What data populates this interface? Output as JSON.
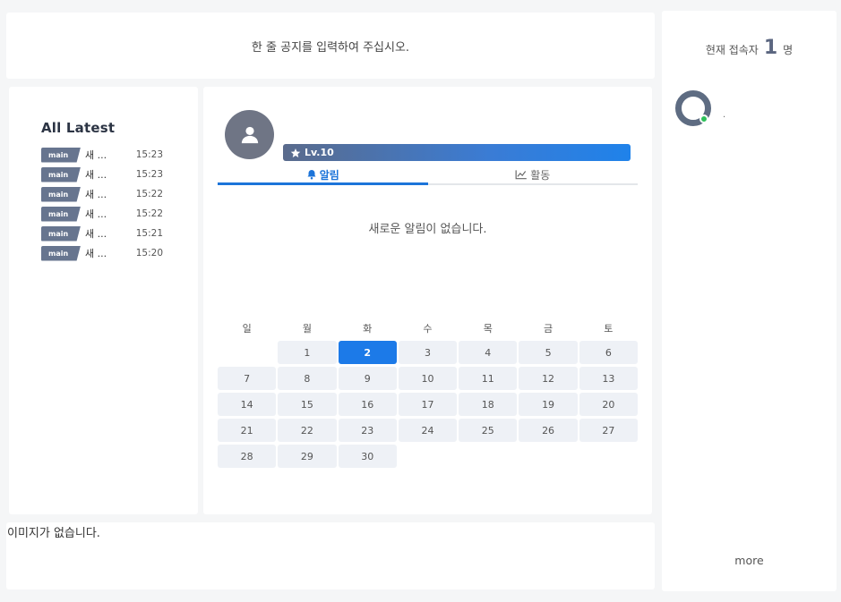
{
  "notice": {
    "text": "한 줄 공지를 입력하여 주십시오."
  },
  "latest": {
    "title": "All Latest",
    "items": [
      {
        "tag": "main",
        "title": "새 ...",
        "time": "15:23"
      },
      {
        "tag": "main",
        "title": "새 ...",
        "time": "15:23"
      },
      {
        "tag": "main",
        "title": "새 ...",
        "time": "15:22"
      },
      {
        "tag": "main",
        "title": "새 ...",
        "time": "15:22"
      },
      {
        "tag": "main",
        "title": "새 ...",
        "time": "15:21"
      },
      {
        "tag": "main",
        "title": "새 ...",
        "time": "15:20"
      }
    ]
  },
  "profile": {
    "avatar_icon": "user-icon",
    "level": "Lv.10",
    "level_icon": "star-icon",
    "tabs": [
      {
        "label": "알림",
        "icon": "bell-icon",
        "active": true
      },
      {
        "label": "활동",
        "icon": "chart-line-icon",
        "active": false
      }
    ],
    "empty_message": "새로운 알림이 없습니다."
  },
  "calendar": {
    "weekdays": [
      "일",
      "월",
      "화",
      "수",
      "목",
      "금",
      "토"
    ],
    "leading_blanks": 1,
    "days": [
      "1",
      "2",
      "3",
      "4",
      "5",
      "6",
      "7",
      "8",
      "9",
      "10",
      "11",
      "12",
      "13",
      "14",
      "15",
      "16",
      "17",
      "18",
      "19",
      "20",
      "21",
      "22",
      "23",
      "24",
      "25",
      "26",
      "27",
      "28",
      "29",
      "30"
    ],
    "today": "2"
  },
  "bottom": {
    "text": "이미지가 없습니다."
  },
  "sidebar": {
    "online_prefix": "현재 접속자",
    "online_count": "1",
    "online_suffix": "명",
    "user_name": ".",
    "more_label": "more"
  },
  "colors": {
    "accent": "#1c7ae8",
    "tag": "#67758f",
    "online": "#2ec05a"
  }
}
